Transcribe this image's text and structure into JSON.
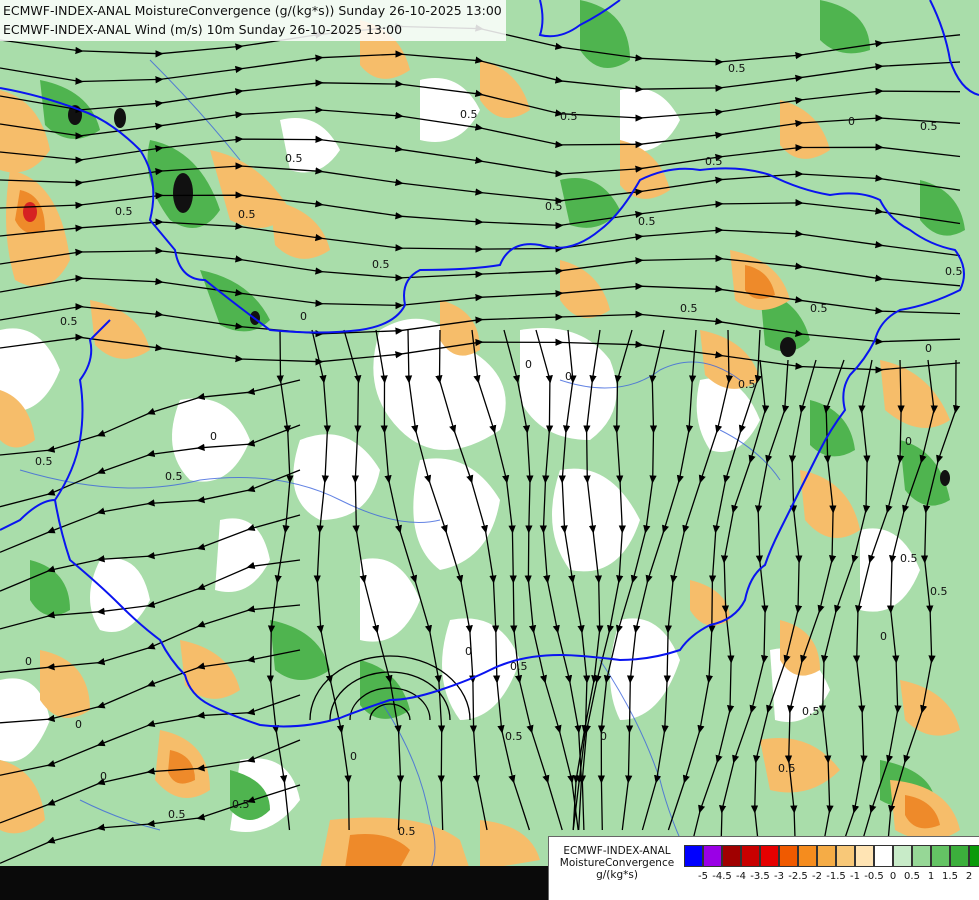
{
  "titles": [
    "ECMWF-INDEX-ANAL MoistureConvergence (g/(kg*s)) Sunday 26-10-2025 13:00",
    "ECMWF-INDEX-ANAL Wind (m/s) 10m Sunday 26-10-2025 13:00"
  ],
  "legend": {
    "title_lines": [
      "ECMWF-INDEX-ANAL",
      "MoistureConvergence",
      "g/(kg*s)"
    ],
    "colors": [
      "#0000ff",
      "#9a00e6",
      "#a00000",
      "#c80000",
      "#e60000",
      "#f05a00",
      "#f58c1e",
      "#f5ac46",
      "#f8c878",
      "#ffe4b4",
      "#ffffff",
      "#c8ebc8",
      "#96d796",
      "#64c364",
      "#3caf3c",
      "#0a9a0a"
    ],
    "ticks": [
      "-5",
      "-4.5",
      "-4",
      "-3.5",
      "-3",
      "-2.5",
      "-2",
      "-1.5",
      "-1",
      "-0.5",
      "0",
      "0.5",
      "1",
      "1.5",
      "2"
    ]
  },
  "contour_labels": [
    "0",
    "0.5"
  ],
  "colors": {
    "border": "#0000ff",
    "river": "#3c64dc",
    "streamline": "#000000",
    "positive": "#82cd82",
    "strong_positive": "#3caa3c",
    "negative": "#f5b450",
    "strong_negative": "#e67814",
    "extreme_negative": "#d21e1e",
    "extreme_positive": "#111111"
  }
}
